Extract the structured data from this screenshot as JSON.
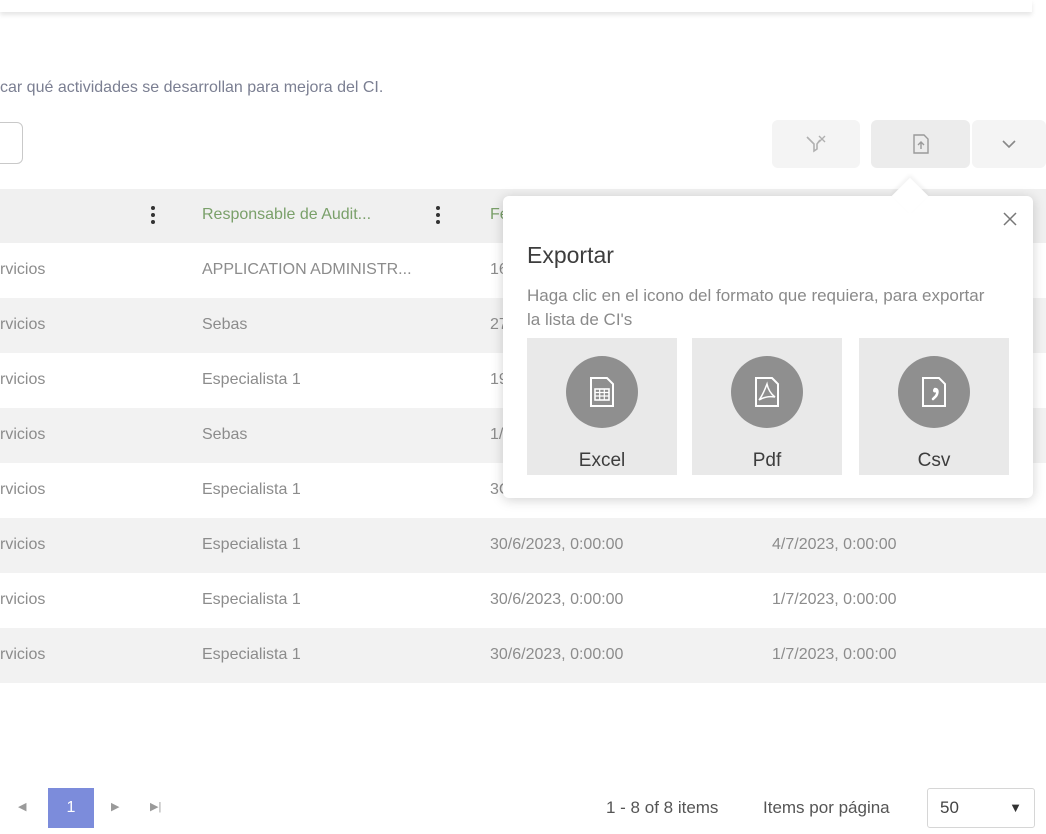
{
  "description": "car qué actividades se desarrollan para mejora del CI.",
  "table": {
    "columns": [
      {
        "label": ""
      },
      {
        "label": "Responsable de Audit..."
      },
      {
        "label": "Fe"
      }
    ],
    "rows": [
      {
        "c1": "rvicios",
        "c2": "APPLICATION ADMINISTR...",
        "c3": "16",
        "c4": ""
      },
      {
        "c1": "rvicios",
        "c2": "Sebas",
        "c3": "27",
        "c4": ""
      },
      {
        "c1": "rvicios",
        "c2": "Especialista 1",
        "c3": "19",
        "c4": ""
      },
      {
        "c1": "rvicios",
        "c2": "Sebas",
        "c3": "1/",
        "c4": ""
      },
      {
        "c1": "rvicios",
        "c2": "Especialista 1",
        "c3": "3C",
        "c4": ""
      },
      {
        "c1": "rvicios",
        "c2": "Especialista 1",
        "c3": "30/6/2023, 0:00:00",
        "c4": "4/7/2023, 0:00:00"
      },
      {
        "c1": "rvicios",
        "c2": "Especialista 1",
        "c3": "30/6/2023, 0:00:00",
        "c4": "1/7/2023, 0:00:00"
      },
      {
        "c1": "rvicios",
        "c2": "Especialista 1",
        "c3": "30/6/2023, 0:00:00",
        "c4": "1/7/2023, 0:00:00"
      }
    ]
  },
  "export_popover": {
    "title": "Exportar",
    "text": "Haga clic en el icono del formato que requiera, para exportar la lista de CI's",
    "formats": [
      {
        "label": "Excel",
        "icon": "excel-icon"
      },
      {
        "label": "Pdf",
        "icon": "pdf-icon"
      },
      {
        "label": "Csv",
        "icon": "csv-icon"
      }
    ]
  },
  "pager": {
    "current_page": "1",
    "info": "1 - 8 of 8 items",
    "per_page_label": "Items por página",
    "per_page_value": "50"
  },
  "colors": {
    "accent": "#7c8cdb",
    "header_text": "#7aa06a",
    "icon_circle": "#8f8f8f"
  }
}
